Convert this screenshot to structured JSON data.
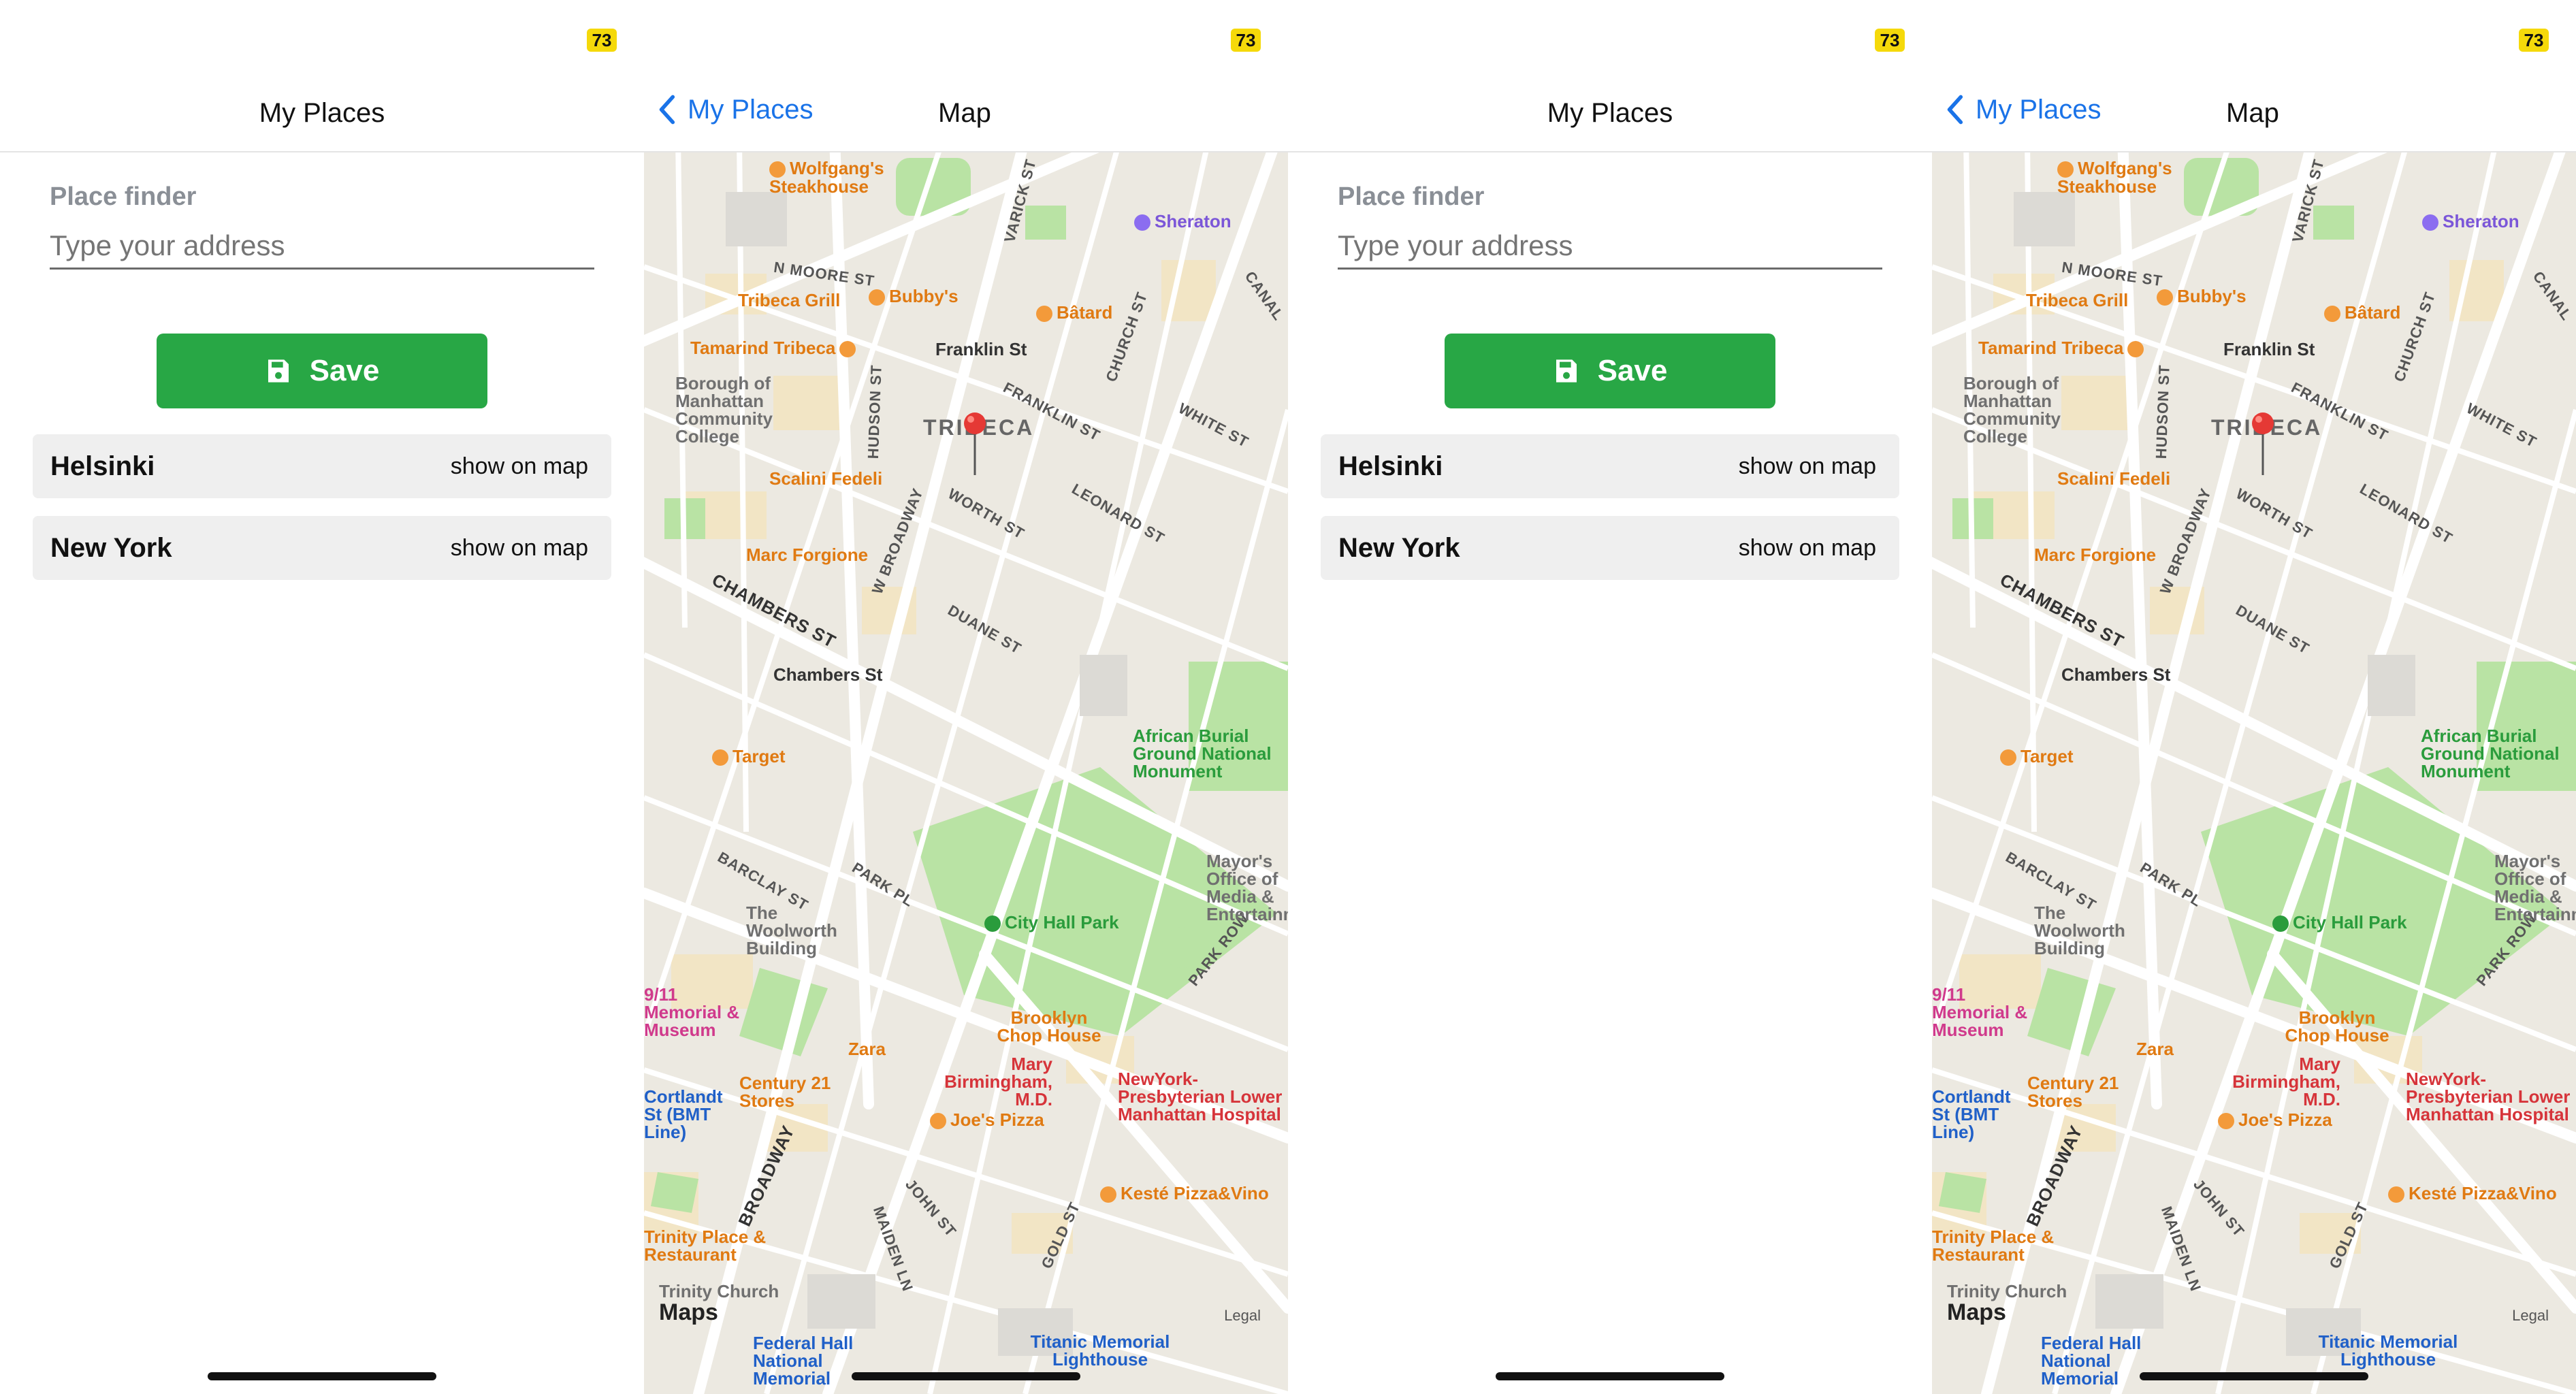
{
  "status": {
    "badge": "73"
  },
  "list_screen": {
    "title": "My Places",
    "label": "Place finder",
    "placeholder": "Type your address",
    "save_label": "Save",
    "places": [
      {
        "name": "Helsinki",
        "action": "show on map"
      },
      {
        "name": "New York",
        "action": "show on map"
      }
    ]
  },
  "map_screen": {
    "back_label": "My Places",
    "title": "Map",
    "maps_logo": "Maps",
    "legal": "Legal",
    "district": "TRIBECA",
    "pois": [
      {
        "name": "Wolfgang's Steakhouse",
        "color": "orange"
      },
      {
        "name": "Sheraton",
        "color": "purple"
      },
      {
        "name": "Tribeca Grill",
        "color": "orange"
      },
      {
        "name": "Bubby's",
        "color": "orange"
      },
      {
        "name": "Bâtard",
        "color": "orange"
      },
      {
        "name": "Tamarind Tribeca",
        "color": "orange"
      },
      {
        "name": "Franklin St",
        "color": "gray"
      },
      {
        "name": "Borough of Manhattan Community College",
        "color": "gray"
      },
      {
        "name": "Scalini Fedeli",
        "color": "orange"
      },
      {
        "name": "Marc Forgione",
        "color": "orange"
      },
      {
        "name": "Chambers St",
        "color": "gray"
      },
      {
        "name": "Target",
        "color": "orange"
      },
      {
        "name": "African Burial Ground National Monument",
        "color": "green"
      },
      {
        "name": "City Hall Park",
        "color": "green"
      },
      {
        "name": "Mayor's Office of Media & Entertainment",
        "color": "gray"
      },
      {
        "name": "The Woolworth Building",
        "color": "gray"
      },
      {
        "name": "Brooklyn Chop House",
        "color": "orange"
      },
      {
        "name": "Zara",
        "color": "orange"
      },
      {
        "name": "Mary Birmingham, M.D.",
        "color": "red"
      },
      {
        "name": "NewYork-Presbyterian Lower Manhattan Hospital",
        "color": "red"
      },
      {
        "name": "Century 21 Stores",
        "color": "orange"
      },
      {
        "name": "Joe's Pizza",
        "color": "orange"
      },
      {
        "name": "Kesté Pizza&Vino",
        "color": "orange"
      },
      {
        "name": "9/11 Memorial & Museum",
        "color": "pink"
      },
      {
        "name": "Cortlandt St (BMT Line)",
        "color": "blue"
      },
      {
        "name": "Trinity Place & Restaurant",
        "color": "orange"
      },
      {
        "name": "Trinity Church",
        "color": "gray"
      },
      {
        "name": "Federal Hall National Memorial",
        "color": "blue"
      },
      {
        "name": "Titanic Memorial Lighthouse",
        "color": "blue"
      }
    ],
    "streets": [
      "VARICK ST",
      "N MOORE ST",
      "HUDSON ST",
      "FRANKLIN ST",
      "CHURCH ST",
      "WHITE ST",
      "CANAL",
      "W BROADWAY",
      "WORTH ST",
      "LEONARD ST",
      "DUANE ST",
      "CHAMBERS ST",
      "BARCLAY ST",
      "PARK PL",
      "PARK ROW",
      "BROADWAY",
      "JOHN ST",
      "MAIDEN LN",
      "GOLD ST"
    ]
  },
  "colors": {
    "accent_blue": "#1a73e8",
    "save_green": "#28a745",
    "badge_yellow": "#f5d90a",
    "park_green": "#b9e3a4",
    "pin_red": "#e53935"
  }
}
